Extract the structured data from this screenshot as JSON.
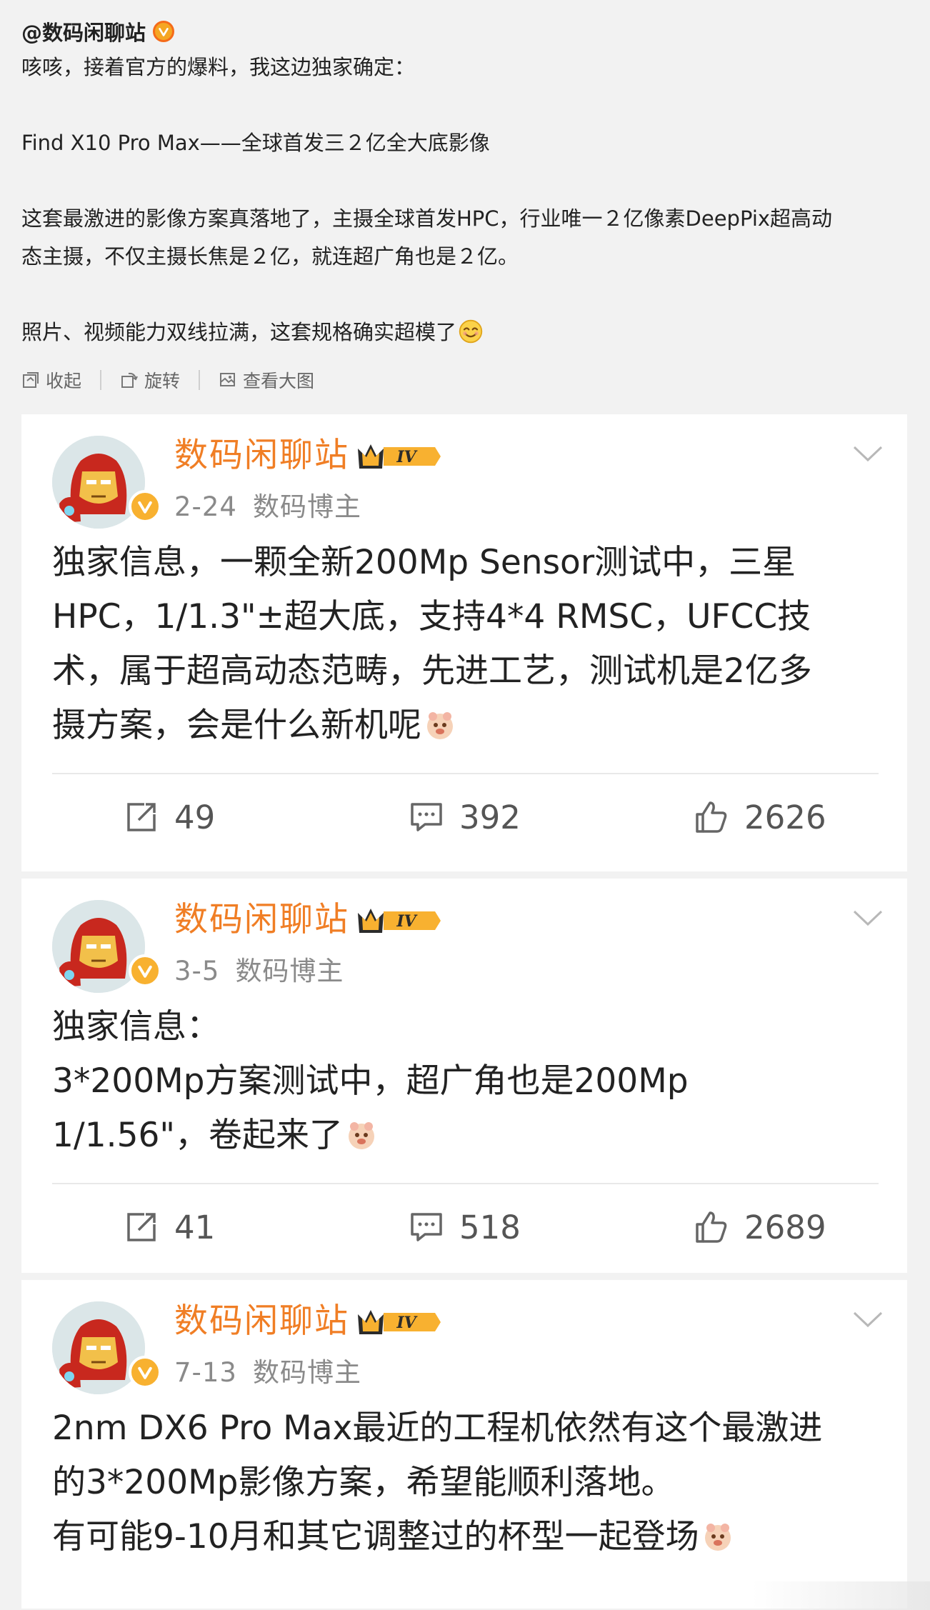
{
  "post": {
    "author": "@数码闲聊站",
    "lines": [
      "咳咳，接着官方的爆料，我这边独家确定：",
      "",
      "Find X10 Pro Max——全球首发三２亿全大底影像",
      "",
      "这套最激进的影像方案真落地了，主摄全球首发HPC，行业唯一２亿像素DeepPix超高动",
      "态主摄，不仅主摄长焦是２亿，就连超广角也是２亿。",
      "",
      "照片、视频能力双线拉满，这套规格确实超模了"
    ],
    "actions": [
      {
        "label": "收起",
        "icon": "collapse-icon"
      },
      {
        "label": "旋转",
        "icon": "rotate-icon"
      },
      {
        "label": "查看大图",
        "icon": "view-large-image-icon"
      }
    ]
  },
  "cards": [
    {
      "name": "数码闲聊站",
      "level": "IV",
      "date": "2-24",
      "role": "数码博主",
      "lines": [
        "独家信息，一颗全新200Mp Sensor测试中，三星",
        "HPC，1/1.3\"±超大底，支持4*4 RMSC，UFCC技",
        "术，属于超高动态范畴，先进工艺，测试机是2亿多",
        "摄方案，会是什么新机呢"
      ],
      "reposts": "49",
      "comments": "392",
      "likes": "2626"
    },
    {
      "name": "数码闲聊站",
      "level": "IV",
      "date": "3-5",
      "role": "数码博主",
      "lines": [
        "独家信息：",
        "3*200Mp方案测试中，超广角也是200Mp",
        "1/1.56\"，卷起来了"
      ],
      "reposts": "41",
      "comments": "518",
      "likes": "2689"
    },
    {
      "name": "数码闲聊站",
      "level": "IV",
      "date": "7-13",
      "role": "数码博主",
      "lines": [
        "2nm DX6 Pro Max最近的工程机依然有这个最激进",
        "的3*200Mp影像方案，希望能顺利落地。",
        "有可能9-10月和其它调整过的杯型一起登场"
      ]
    }
  ],
  "colors": {
    "accent_name": "#f07e25",
    "badge_gold": "#f8b130",
    "background": "#f2f2f2"
  }
}
